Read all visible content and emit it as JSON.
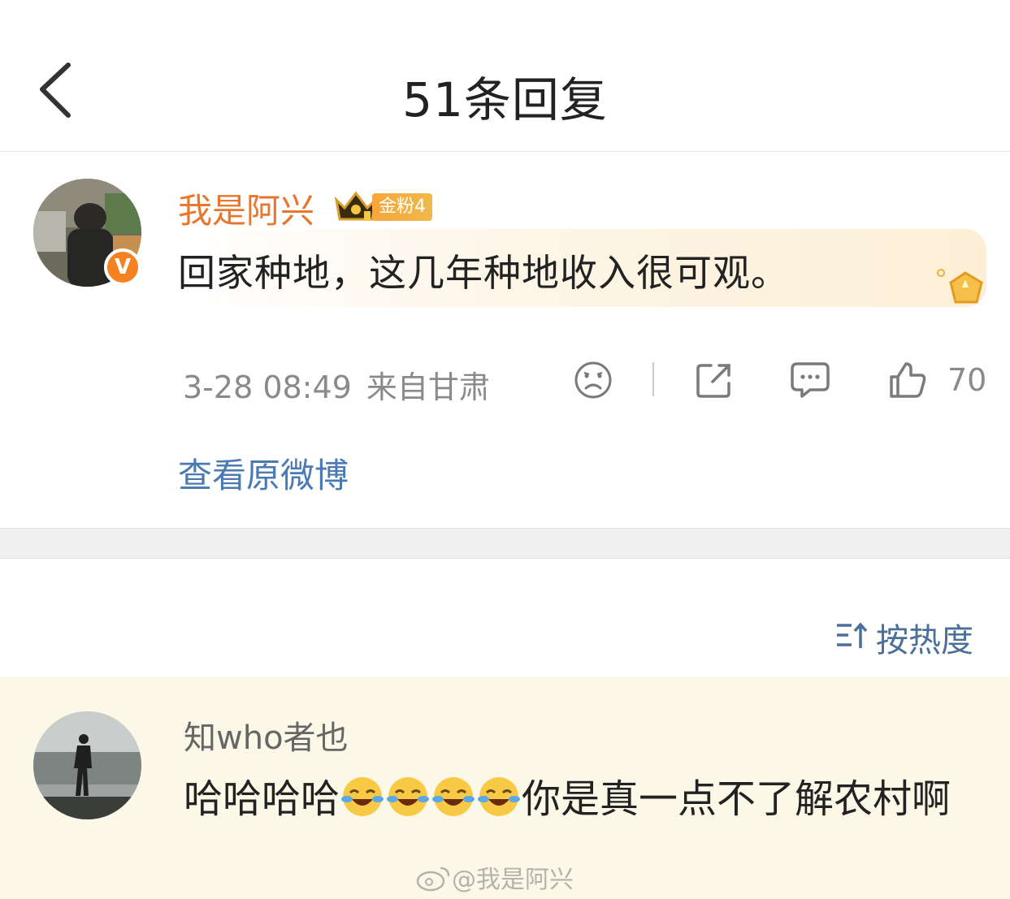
{
  "header": {
    "title": "51条回复"
  },
  "comment": {
    "username": "我是阿兴",
    "fan_badge": "金粉4",
    "text": "回家种地，这几年种地收入很可观。",
    "time": "3-28 08:49",
    "location": "来自甘肃",
    "like_count": "70",
    "view_original": "查看原微博",
    "icons": [
      "sad-face-icon",
      "share-icon",
      "comment-icon",
      "thumbs-up-icon"
    ]
  },
  "sort": {
    "label": "按热度"
  },
  "reply": {
    "username": "知who者也",
    "text_before": "哈哈哈哈",
    "emoji_count": 4,
    "text_after": "你是真一点不了解农村啊"
  },
  "watermark": {
    "text": "@我是阿兴"
  },
  "colors": {
    "username_orange": "#e8762d",
    "link_blue": "#4a79b4",
    "reply_bg": "#fcf8e8",
    "verified_badge": "#f58220"
  }
}
